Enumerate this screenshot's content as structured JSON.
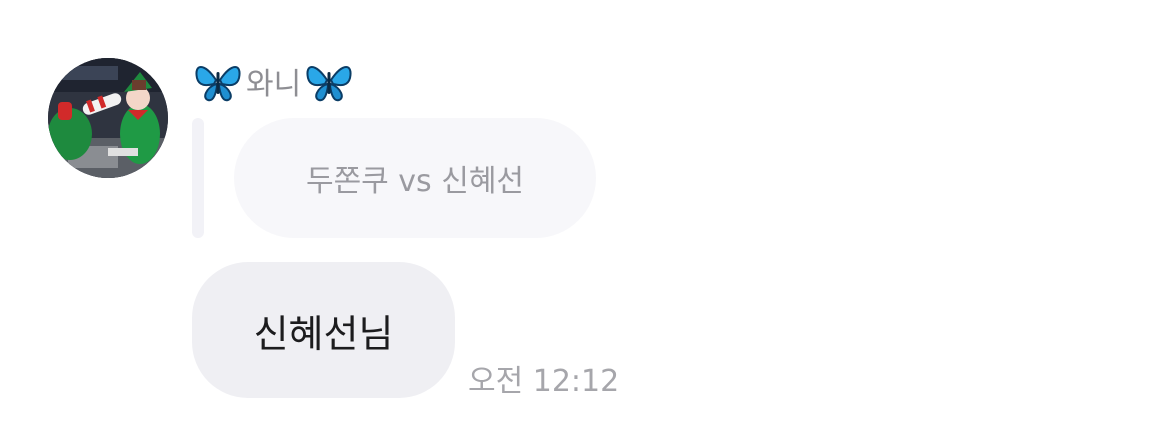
{
  "sender": {
    "name": "와니",
    "left_icon": "butterfly-icon",
    "right_icon": "butterfly-icon",
    "icon_color": "#2aa7e8"
  },
  "reply": {
    "quoted_text": "두쫀쿠 vs 신혜선"
  },
  "message": {
    "text": "신혜선님",
    "time": "오전 12:12"
  },
  "colors": {
    "bubble": "#efeff3",
    "quoted_bubble": "#f7f7fa",
    "muted_text": "#9a9aa0"
  }
}
